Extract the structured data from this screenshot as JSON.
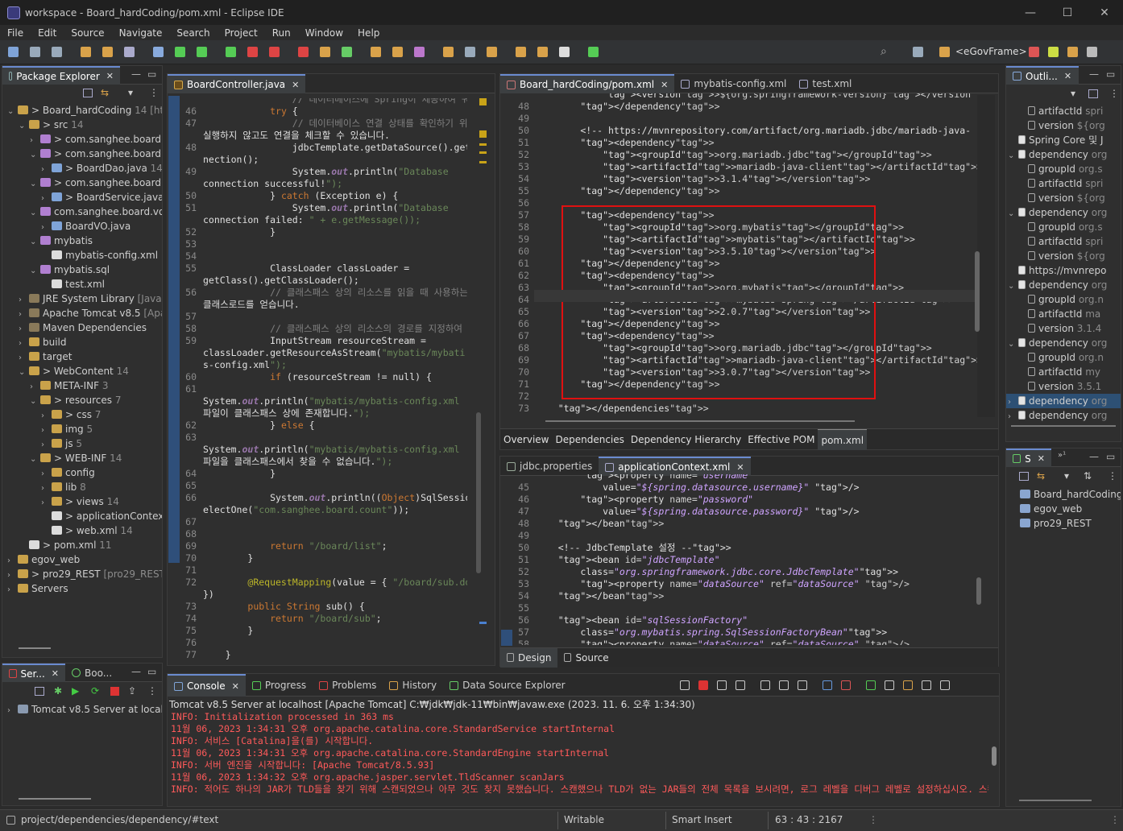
{
  "window": {
    "title": "workspace - Board_hardCoding/pom.xml - Eclipse IDE"
  },
  "menu": [
    "File",
    "Edit",
    "Source",
    "Navigate",
    "Search",
    "Project",
    "Run",
    "Window",
    "Help"
  ],
  "toolbar": {
    "perspective": "<eGovFrame>"
  },
  "package_explorer": {
    "tab": "Package Explorer",
    "items": [
      {
        "indent": 0,
        "tw": "⌄",
        "text": "> Board_hardCoding",
        "dim": " 14 [http",
        "color": "#c9a24a"
      },
      {
        "indent": 1,
        "tw": "⌄",
        "text": "> src",
        "dim": " 14",
        "color": "#c9a24a"
      },
      {
        "indent": 2,
        "tw": "›",
        "text": "> com.sanghee.board.c",
        "dim": "",
        "color": "#b07fd0"
      },
      {
        "indent": 2,
        "tw": "⌄",
        "text": "> com.sanghee.board.c",
        "dim": "",
        "color": "#b07fd0"
      },
      {
        "indent": 3,
        "tw": "›",
        "text": "> BoardDao.java",
        "dim": " 14",
        "color": "#7fa4d8"
      },
      {
        "indent": 2,
        "tw": "⌄",
        "text": "> com.sanghee.board.s",
        "dim": "",
        "color": "#b07fd0"
      },
      {
        "indent": 3,
        "tw": "›",
        "text": "> BoardService.java",
        "dim": " 14",
        "color": "#7fa4d8"
      },
      {
        "indent": 2,
        "tw": "⌄",
        "text": "com.sanghee.board.vo",
        "dim": "",
        "color": "#b07fd0"
      },
      {
        "indent": 3,
        "tw": "›",
        "text": "BoardVO.java",
        "dim": "",
        "color": "#7fa4d8"
      },
      {
        "indent": 2,
        "tw": "⌄",
        "text": "mybatis",
        "dim": "",
        "color": "#b07fd0"
      },
      {
        "indent": 3,
        "tw": "",
        "text": "mybatis-config.xml",
        "dim": "",
        "color": "#dcdcdc"
      },
      {
        "indent": 2,
        "tw": "⌄",
        "text": "mybatis.sql",
        "dim": "",
        "color": "#b07fd0"
      },
      {
        "indent": 3,
        "tw": "",
        "text": "test.xml",
        "dim": "",
        "color": "#dcdcdc"
      },
      {
        "indent": 1,
        "tw": "›",
        "text": "JRE System Library",
        "dim": " [JavaSE",
        "color": "#8a7a5a"
      },
      {
        "indent": 1,
        "tw": "›",
        "text": "Apache Tomcat v8.5",
        "dim": " [Apa",
        "color": "#8a7a5a"
      },
      {
        "indent": 1,
        "tw": "›",
        "text": "Maven Dependencies",
        "dim": "",
        "color": "#8a7a5a"
      },
      {
        "indent": 1,
        "tw": "›",
        "text": "build",
        "dim": "",
        "color": "#c9a24a"
      },
      {
        "indent": 1,
        "tw": "›",
        "text": "target",
        "dim": "",
        "color": "#c9a24a"
      },
      {
        "indent": 1,
        "tw": "⌄",
        "text": "> WebContent",
        "dim": " 14",
        "color": "#c9a24a"
      },
      {
        "indent": 2,
        "tw": "›",
        "text": "META-INF",
        "dim": " 3",
        "color": "#c9a24a"
      },
      {
        "indent": 2,
        "tw": "⌄",
        "text": "> resources",
        "dim": " 7",
        "color": "#c9a24a"
      },
      {
        "indent": 3,
        "tw": "›",
        "text": "> css",
        "dim": " 7",
        "color": "#c9a24a"
      },
      {
        "indent": 3,
        "tw": "›",
        "text": "img",
        "dim": " 5",
        "color": "#c9a24a"
      },
      {
        "indent": 3,
        "tw": "›",
        "text": "js",
        "dim": " 5",
        "color": "#c9a24a"
      },
      {
        "indent": 2,
        "tw": "⌄",
        "text": "> WEB-INF",
        "dim": " 14",
        "color": "#c9a24a"
      },
      {
        "indent": 3,
        "tw": "›",
        "text": "config",
        "dim": "",
        "color": "#c9a24a"
      },
      {
        "indent": 3,
        "tw": "›",
        "text": "lib",
        "dim": " 8",
        "color": "#c9a24a"
      },
      {
        "indent": 3,
        "tw": "›",
        "text": "> views",
        "dim": " 14",
        "color": "#c9a24a"
      },
      {
        "indent": 3,
        "tw": "",
        "text": "> applicationContex",
        "dim": "",
        "color": "#dcdcdc"
      },
      {
        "indent": 3,
        "tw": "",
        "text": "> web.xml",
        "dim": " 14",
        "color": "#dcdcdc"
      },
      {
        "indent": 1,
        "tw": "",
        "text": "> pom.xml",
        "dim": " 11",
        "color": "#dcdcdc"
      },
      {
        "indent": 0,
        "tw": "›",
        "text": "egov_web",
        "dim": "",
        "color": "#c9a24a"
      },
      {
        "indent": 0,
        "tw": "›",
        "text": "> pro29_REST",
        "dim": " [pro29_REST r",
        "color": "#c9a24a"
      },
      {
        "indent": 0,
        "tw": "›",
        "text": "Servers",
        "dim": "",
        "color": "#c9a24a"
      }
    ]
  },
  "servers_panel": {
    "tab1": "Ser...",
    "tab2": "Boo...",
    "item": "Tomcat v8.5 Server at localh"
  },
  "board_controller": {
    "tab": "BoardController.java",
    "lines": [
      {
        "n": "",
        "t": "\t\t\t\t// 데이터베이스에 Spring이 제공하여 쿼리를 보내는 방법"
      },
      {
        "n": "46",
        "t": "\t\t\ttry {"
      },
      {
        "n": "47",
        "t": "\t\t\t\t// 데이터베이스 연결 상태를 확인하기 위해 쿼리를"
      },
      {
        "n": "",
        "t": "실행하지 않고도 연결을 체크할 수 있습니다."
      },
      {
        "n": "48",
        "t": "\t\t\t\tjdbcTemplate.getDataSource().getCon"
      },
      {
        "n": "",
        "t": "nection();"
      },
      {
        "n": "49",
        "t": "\t\t\t\tSystem.out.println(\"Database"
      },
      {
        "n": "",
        "t": "connection successful!\");"
      },
      {
        "n": "50",
        "t": "\t\t\t} catch (Exception e) {"
      },
      {
        "n": "51",
        "t": "\t\t\t\tSystem.out.println(\"Database"
      },
      {
        "n": "",
        "t": "connection failed: \" + e.getMessage());"
      },
      {
        "n": "52",
        "t": "\t\t\t}"
      },
      {
        "n": "53",
        "t": ""
      },
      {
        "n": "54",
        "t": ""
      },
      {
        "n": "55",
        "t": "\t\t\tClassLoader classLoader ="
      },
      {
        "n": "",
        "t": "getClass().getClassLoader();"
      },
      {
        "n": "56",
        "t": "\t\t\t// 클래스패스 상의 리소스를 읽을 때 사용하는"
      },
      {
        "n": "",
        "t": "클래스로드를 얻습니다."
      },
      {
        "n": "57",
        "t": ""
      },
      {
        "n": "58",
        "t": "\t\t\t// 클래스패스 상의 리소스의 경로를 지정하여 읽습니다."
      },
      {
        "n": "59",
        "t": "\t\t\tInputStream resourceStream ="
      },
      {
        "n": "",
        "t": "classLoader.getResourceAsStream(\"mybatis/mybati"
      },
      {
        "n": "",
        "t": "s-config.xml\");"
      },
      {
        "n": "60",
        "t": "\t\t\tif (resourceStream != null) {"
      },
      {
        "n": "61",
        "t": ""
      },
      {
        "n": "",
        "t": "System.out.println(\"mybatis/mybatis-config.xml"
      },
      {
        "n": "",
        "t": "파일이 클래스패스 상에 존재합니다.\");"
      },
      {
        "n": "62",
        "t": "\t\t\t} else {"
      },
      {
        "n": "63",
        "t": ""
      },
      {
        "n": "",
        "t": "System.out.println(\"mybatis/mybatis-config.xml"
      },
      {
        "n": "",
        "t": "파일을 클래스패스에서 찾을 수 없습니다.\");"
      },
      {
        "n": "64",
        "t": "\t\t\t}"
      },
      {
        "n": "65",
        "t": ""
      },
      {
        "n": "66",
        "t": "\t\t\tSystem.out.println((Object)SqlSession.s"
      },
      {
        "n": "",
        "t": "electOne(\"com.sanghee.board.count\"));"
      },
      {
        "n": "67",
        "t": ""
      },
      {
        "n": "68",
        "t": ""
      },
      {
        "n": "69",
        "t": "\t\t\treturn \"/board/list\";"
      },
      {
        "n": "70",
        "t": "\t\t}"
      },
      {
        "n": "71",
        "t": ""
      },
      {
        "n": "72",
        "t": "\t\t@RequestMapping(value = { \"/board/sub.do\""
      },
      {
        "n": "",
        "t": "})"
      },
      {
        "n": "73",
        "t": "\t\tpublic String sub() {"
      },
      {
        "n": "74",
        "t": "\t\t\treturn \"/board/sub\";"
      },
      {
        "n": "75",
        "t": "\t\t}"
      },
      {
        "n": "76",
        "t": ""
      },
      {
        "n": "77",
        "t": "\t}"
      },
      {
        "n": "78",
        "t": ""
      }
    ]
  },
  "pom_editor": {
    "tabs": [
      "Board_hardCoding/pom.xml",
      "mybatis-config.xml",
      "test.xml"
    ],
    "lines": [
      {
        "n": "",
        "t": "            <version>${org.springframework-version}</version>"
      },
      {
        "n": "48",
        "t": "        </dependency>"
      },
      {
        "n": "49",
        "t": ""
      },
      {
        "n": "50",
        "t": "        <!-- https://mvnrepository.com/artifact/org.mariadb.jdbc/mariadb-java-"
      },
      {
        "n": "51",
        "t": "        <dependency>"
      },
      {
        "n": "52",
        "t": "            <groupId>org.mariadb.jdbc</groupId>"
      },
      {
        "n": "53",
        "t": "            <artifactId>mariadb-java-client</artifactId>"
      },
      {
        "n": "54",
        "t": "            <version>3.1.4</version>"
      },
      {
        "n": "55",
        "t": "        </dependency>"
      },
      {
        "n": "56",
        "t": ""
      },
      {
        "n": "57",
        "t": "        <dependency>"
      },
      {
        "n": "58",
        "t": "            <groupId>org.mybatis</groupId>"
      },
      {
        "n": "59",
        "t": "            <artifactId>mybatis</artifactId>"
      },
      {
        "n": "60",
        "t": "            <version>3.5.10</version>"
      },
      {
        "n": "61",
        "t": "        </dependency>"
      },
      {
        "n": "62",
        "t": "        <dependency>"
      },
      {
        "n": "63",
        "t": "            <groupId>org.mybatis</groupId>"
      },
      {
        "n": "64",
        "t": "            <artifactId>mybatis-spring</artifactId>"
      },
      {
        "n": "65",
        "t": "            <version>2.0.7</version>"
      },
      {
        "n": "66",
        "t": "        </dependency>"
      },
      {
        "n": "67",
        "t": "        <dependency>"
      },
      {
        "n": "68",
        "t": "            <groupId>org.mariadb.jdbc</groupId>"
      },
      {
        "n": "69",
        "t": "            <artifactId>mariadb-java-client</artifactId>"
      },
      {
        "n": "70",
        "t": "            <version>3.0.7</version>"
      },
      {
        "n": "71",
        "t": "        </dependency>"
      },
      {
        "n": "72",
        "t": ""
      },
      {
        "n": "73",
        "t": "    </dependencies>"
      }
    ],
    "bottom_tabs": [
      "Overview",
      "Dependencies",
      "Dependency Hierarchy",
      "Effective POM",
      "pom.xml"
    ]
  },
  "app_context_editor": {
    "tabs": [
      "jdbc.properties",
      "applicationContext.xml"
    ],
    "lines": [
      {
        "n": "",
        "t": "        <property name=\"username\""
      },
      {
        "n": "45",
        "t": "            value=\"${spring.datasource.username}\" />"
      },
      {
        "n": "46",
        "t": "        <property name=\"password\""
      },
      {
        "n": "47",
        "t": "            value=\"${spring.datasource.password}\" />"
      },
      {
        "n": "48",
        "t": "    </bean>"
      },
      {
        "n": "49",
        "t": ""
      },
      {
        "n": "50",
        "t": "    <!-- JdbcTemplate 설정 -->"
      },
      {
        "n": "51",
        "t": "    <bean id=\"jdbcTemplate\""
      },
      {
        "n": "52",
        "t": "        class=\"org.springframework.jdbc.core.JdbcTemplate\">"
      },
      {
        "n": "53",
        "t": "        <property name=\"dataSource\" ref=\"dataSource\" />"
      },
      {
        "n": "54",
        "t": "    </bean>"
      },
      {
        "n": "55",
        "t": ""
      },
      {
        "n": "56",
        "t": "    <bean id=\"sqlSessionFactory\""
      },
      {
        "n": "57",
        "t": "        class=\"org.mybatis.spring.SqlSessionFactoryBean\">"
      },
      {
        "n": "58",
        "t": "        <property name=\"dataSource\" ref=\"dataSource\" />"
      }
    ],
    "bottom_tabs": [
      "Design",
      "Source"
    ]
  },
  "outline": {
    "tab": "Outli...",
    "items": [
      {
        "indent": 1,
        "tw": "",
        "text": "artifactId",
        "dim": " spri"
      },
      {
        "indent": 1,
        "tw": "",
        "text": "version",
        "dim": " ${org"
      },
      {
        "indent": 0,
        "tw": "",
        "text": "Spring Core 및 J",
        "dim": ""
      },
      {
        "indent": 0,
        "tw": "⌄",
        "text": "dependency",
        "dim": " org"
      },
      {
        "indent": 1,
        "tw": "",
        "text": "groupId",
        "dim": " org.s"
      },
      {
        "indent": 1,
        "tw": "",
        "text": "artifactId",
        "dim": " spri"
      },
      {
        "indent": 1,
        "tw": "",
        "text": "version",
        "dim": " ${org"
      },
      {
        "indent": 0,
        "tw": "⌄",
        "text": "dependency",
        "dim": " org"
      },
      {
        "indent": 1,
        "tw": "",
        "text": "groupId",
        "dim": " org.s"
      },
      {
        "indent": 1,
        "tw": "",
        "text": "artifactId",
        "dim": " spri"
      },
      {
        "indent": 1,
        "tw": "",
        "text": "version",
        "dim": " ${org"
      },
      {
        "indent": 0,
        "tw": "",
        "text": "https://mvnrepo",
        "dim": ""
      },
      {
        "indent": 0,
        "tw": "⌄",
        "text": "dependency",
        "dim": " org"
      },
      {
        "indent": 1,
        "tw": "",
        "text": "groupId",
        "dim": " org.n"
      },
      {
        "indent": 1,
        "tw": "",
        "text": "artifactId",
        "dim": " ma"
      },
      {
        "indent": 1,
        "tw": "",
        "text": "version",
        "dim": " 3.1.4"
      },
      {
        "indent": 0,
        "tw": "⌄",
        "text": "dependency",
        "dim": " org"
      },
      {
        "indent": 1,
        "tw": "",
        "text": "groupId",
        "dim": " org.n"
      },
      {
        "indent": 1,
        "tw": "",
        "text": "artifactId",
        "dim": " my"
      },
      {
        "indent": 1,
        "tw": "",
        "text": "version",
        "dim": " 3.5.1"
      },
      {
        "indent": 0,
        "tw": "›",
        "text": "dependency",
        "dim": " org",
        "selected": true
      },
      {
        "indent": 0,
        "tw": "›",
        "text": "dependency",
        "dim": " org"
      }
    ]
  },
  "servers_right": {
    "tab": "S",
    "items": [
      "Board_hardCoding",
      "egov_web",
      "pro29_REST"
    ]
  },
  "console": {
    "tabs": [
      "Console",
      "Progress",
      "Problems",
      "History",
      "Data Source Explorer"
    ],
    "header": "Tomcat v8.5 Server at localhost [Apache Tomcat] C:₩jdk₩jdk-11₩bin₩javaw.exe  (2023. 11. 6. 오후 1:34:30)",
    "lines": [
      "INFO: Initialization processed in 363 ms",
      "11월 06, 2023 1:34:31 오후 org.apache.catalina.core.StandardService startInternal",
      "INFO: 서비스 [Catalina]을(를) 시작합니다.",
      "11월 06, 2023 1:34:31 오후 org.apache.catalina.core.StandardEngine startInternal",
      "INFO: 서버 엔진을 시작합니다: [Apache Tomcat/8.5.93]",
      "11월 06, 2023 1:34:32 오후 org.apache.jasper.servlet.TldScanner scanJars",
      "INFO: 적어도 하나의 JAR가 TLD들을 찾기 위해 스캔되었으나 아무 것도 찾지 못했습니다. 스캔했으나 TLD가 없는 JAR들의 전체 목록을 보시려면, 로그 레벨을 디버그 레벨로 설정하십시오. 스캔 과정에서 불필요"
    ]
  },
  "status": {
    "path": "project/dependencies/dependency/#text",
    "mode": "Writable",
    "insert": "Smart Insert",
    "position": "63 : 43 : 2167"
  }
}
